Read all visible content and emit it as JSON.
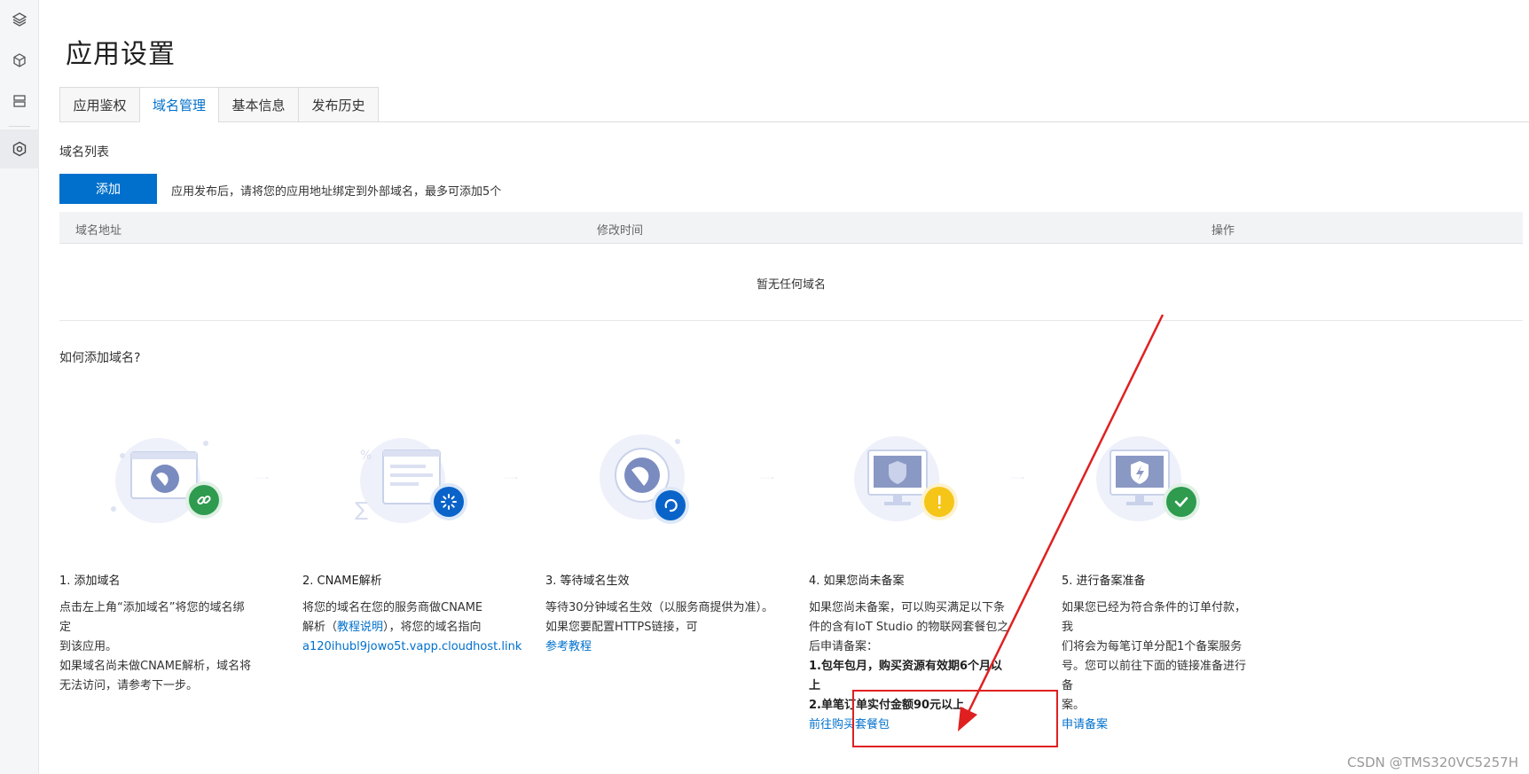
{
  "page": {
    "title": "应用设置"
  },
  "tabs": [
    "应用鉴权",
    "域名管理",
    "基本信息",
    "发布历史"
  ],
  "domain_list": {
    "section_label": "域名列表",
    "add_button": "添加",
    "hint": "应用发布后，请将您的应用地址绑定到外部域名，最多可添加5个",
    "columns": [
      "域名地址",
      "修改时间",
      "操作"
    ],
    "empty_text": "暂无任何域名"
  },
  "howto": {
    "title": "如何添加域名?",
    "steps": [
      {
        "title": "1. 添加域名",
        "lines": [
          "点击左上角“添加域名”将您的域名绑定",
          "到该应用。",
          "如果域名尚未做CNAME解析，域名将",
          "无法访问，请参考下一步。"
        ],
        "icon": "link-icon"
      },
      {
        "title": "2. CNAME解析",
        "line1": "将您的域名在您的服务商做CNAME",
        "line2_prefix": "解析（",
        "line2_link": "教程说明",
        "line2_suffix": "），将您的域名指向",
        "cname_target": "a120ihubl9jowo5t.vapp.cloudhost.link",
        "icon": "loading-icon"
      },
      {
        "title": "3. 等待域名生效",
        "lines": [
          "等待30分钟域名生效（以服务商提供为准）。",
          "如果您要配置HTTPS链接，可"
        ],
        "link": "参考教程",
        "icon": "refresh-icon"
      },
      {
        "title": "4. 如果您尚未备案",
        "lines": [
          "如果您尚未备案，可以购买满足以下条",
          "件的含有IoT Studio 的物联网套餐包之",
          "后申请备案："
        ],
        "bold_lines": [
          "1.包年包月，购买资源有效期6个月以",
          "上",
          "2.单笔订单实付金额90元以上"
        ],
        "link": "前往购买套餐包",
        "icon": "warning-icon"
      },
      {
        "title": "5. 进行备案准备",
        "lines": [
          "如果您已经为符合条件的订单付款，我",
          "们将会为每笔订单分配1个备案服务",
          "号。您可以前往下面的链接准备进行备",
          "案。"
        ],
        "link": "申请备案",
        "icon": "check-icon"
      }
    ]
  },
  "watermark": "CSDN @TMS320VC5257H",
  "colors": {
    "accent": "#0070cc",
    "annotation_red": "#e02020",
    "success": "#2e9b4f",
    "warning": "#f5c518"
  }
}
